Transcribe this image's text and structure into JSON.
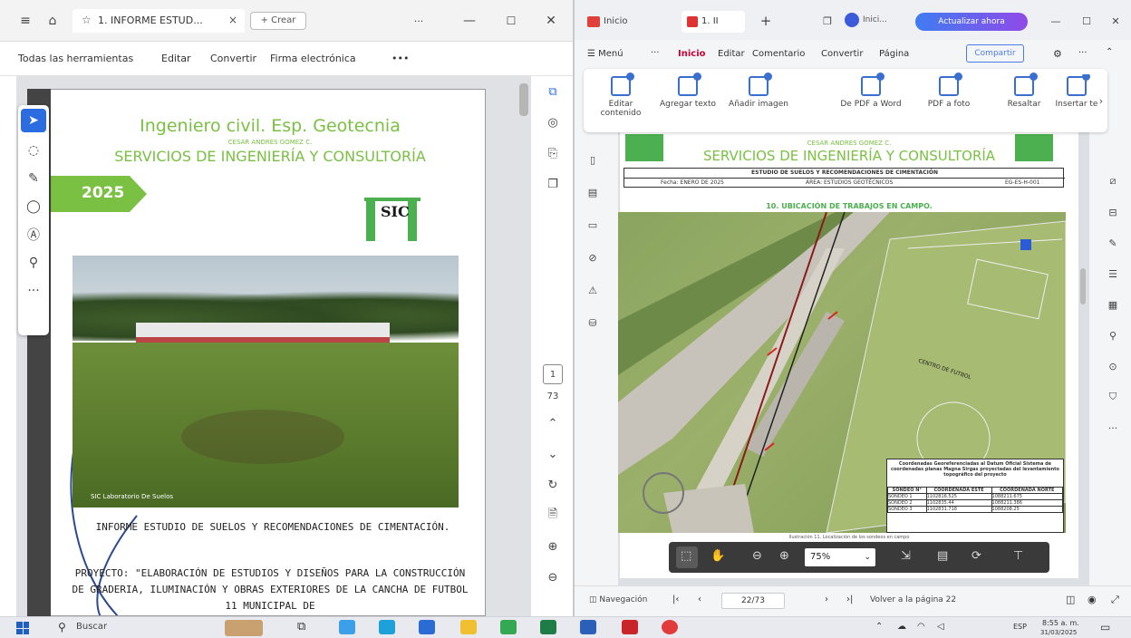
{
  "left": {
    "tab_title": "1. INFORME ESTUD...",
    "tab_close": "×",
    "new_tab": "+ Crear",
    "menu": [
      "Todas las herramientas",
      "Editar",
      "Convertir",
      "Firma electrónica",
      "•••"
    ],
    "page_current": "1",
    "page_total": "73",
    "cover": {
      "title": "Ingeniero civil. Esp. Geotecnia",
      "name": "CESAR ANDRES GOMEZ C.",
      "company": "SERVICIOS DE INGENIERÍA Y CONSULTORÍA",
      "year": "2025",
      "logo": "SIC",
      "photo_caption": "SIC Laboratorio De Suelos",
      "report": "INFORME ESTUDIO DE SUELOS Y RECOMENDACIONES DE CIMENTACIÓN.",
      "project": "PROYECTO: \"ELABORACIÓN DE ESTUDIOS Y DISEÑOS PARA LA CONSTRUCCIÓN DE GRADERIA, ILUMINACIÓN Y OBRAS EXTERIORES DE LA CANCHA DE FUTBOL 11 MUNICIPAL DE"
    }
  },
  "right": {
    "tab1": "Inicio",
    "tab2": "1. II",
    "user": "Inici...",
    "update_btn": "Actualizar ahora",
    "menu_label": "Menú",
    "menu": [
      "Inicio",
      "Editar",
      "Comentario",
      "Convertir",
      "Página"
    ],
    "share": "Compartir",
    "ribbon": [
      "Editar contenido",
      "Agregar texto",
      "Añadir imagen",
      "De PDF a Word",
      "PDF a foto",
      "Resaltar",
      "Insertar te"
    ],
    "doc_header": {
      "name": "CESAR ANDRES GOMEZ C.",
      "company": "SERVICIOS DE INGENIERÍA Y CONSULTORÍA",
      "study": "ESTUDIO DE SUELOS Y RECOMENDACIONES DE CIMENTACIÓN",
      "date": "Fecha: ENERO DE 2025",
      "area": "ÁREA: ESTUDIOS GEOTÉCNICOS",
      "code": "EG-ES-H-001"
    },
    "section": "10. UBICACIÓN DE TRABAJOS EN CAMPO.",
    "map_label": "CENTRO DE FUTBOL",
    "coord_table": {
      "title": "Coordenadas Georeferenciadas al Datum Oficial Sistema de coordenadas planas Magna Sirgas proyectadas del levantamiento topográfico del proyecto",
      "headers": [
        "SONDEO N°",
        "COORDENADA ESTE",
        "COORDENADA NORTE"
      ],
      "rows": [
        [
          "SONDEO 1",
          "1102816.525",
          "1088211.675"
        ],
        [
          "SONDEO 2",
          "1102835.44",
          "1088211.386"
        ],
        [
          "SONDEO 3",
          "1102831.718",
          "1088208.25"
        ]
      ]
    },
    "figure_caption": "Ilustración 11. Localización de los sondeos en campo",
    "zoom": "75%",
    "nav_label": "Navegación",
    "page_input": "22/73",
    "back_label": "Volver a la página 22"
  },
  "taskbar": {
    "search": "Buscar",
    "lang": "ESP",
    "time": "8:55 a. m.",
    "date": "31/03/2025"
  }
}
